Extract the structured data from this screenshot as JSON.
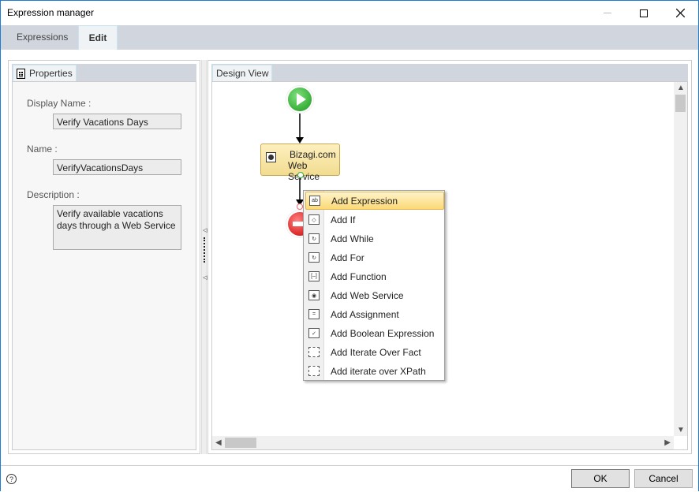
{
  "window": {
    "title": "Expression manager",
    "minimize_icon": "minimize-icon",
    "maximize_icon": "maximize-icon",
    "close_icon": "close-icon"
  },
  "tabs": [
    {
      "label": "Expressions",
      "active": false
    },
    {
      "label": "Edit",
      "active": true
    }
  ],
  "properties": {
    "tab_label": "Properties",
    "tab_icon": "properties-grid-icon",
    "display_name_label": "Display Name :",
    "display_name_value": "Verify Vacations Days",
    "name_label": "Name :",
    "name_value": "VerifyVacationsDays",
    "description_label": "Description :",
    "description_value": "Verify available vacations days through a Web Service"
  },
  "design_view": {
    "tab_label": "Design View",
    "start_node_icon": "start-play-icon",
    "task_node": {
      "line1": "Bizagi.com",
      "line2": "Web Service",
      "icon": "web-service-icon"
    },
    "end_node_icon": "end-stop-icon"
  },
  "context_menu": {
    "items": [
      {
        "label": "Add Expression",
        "icon": "expression-icon",
        "highlighted": true
      },
      {
        "label": "Add If",
        "icon": "if-icon",
        "highlighted": false
      },
      {
        "label": "Add While",
        "icon": "while-icon",
        "highlighted": false
      },
      {
        "label": "Add For",
        "icon": "for-icon",
        "highlighted": false
      },
      {
        "label": "Add Function",
        "icon": "function-icon",
        "highlighted": false
      },
      {
        "label": "Add Web Service",
        "icon": "web-service-icon",
        "highlighted": false
      },
      {
        "label": "Add Assignment",
        "icon": "assignment-icon",
        "highlighted": false
      },
      {
        "label": "Add Boolean Expression",
        "icon": "boolean-icon",
        "highlighted": false
      },
      {
        "label": "Add Iterate Over Fact",
        "icon": "iterate-fact-icon",
        "highlighted": false
      },
      {
        "label": "Add iterate over XPath",
        "icon": "iterate-xpath-icon",
        "highlighted": false
      }
    ]
  },
  "footer": {
    "help_icon": "help-icon",
    "ok_label": "OK",
    "cancel_label": "Cancel"
  }
}
